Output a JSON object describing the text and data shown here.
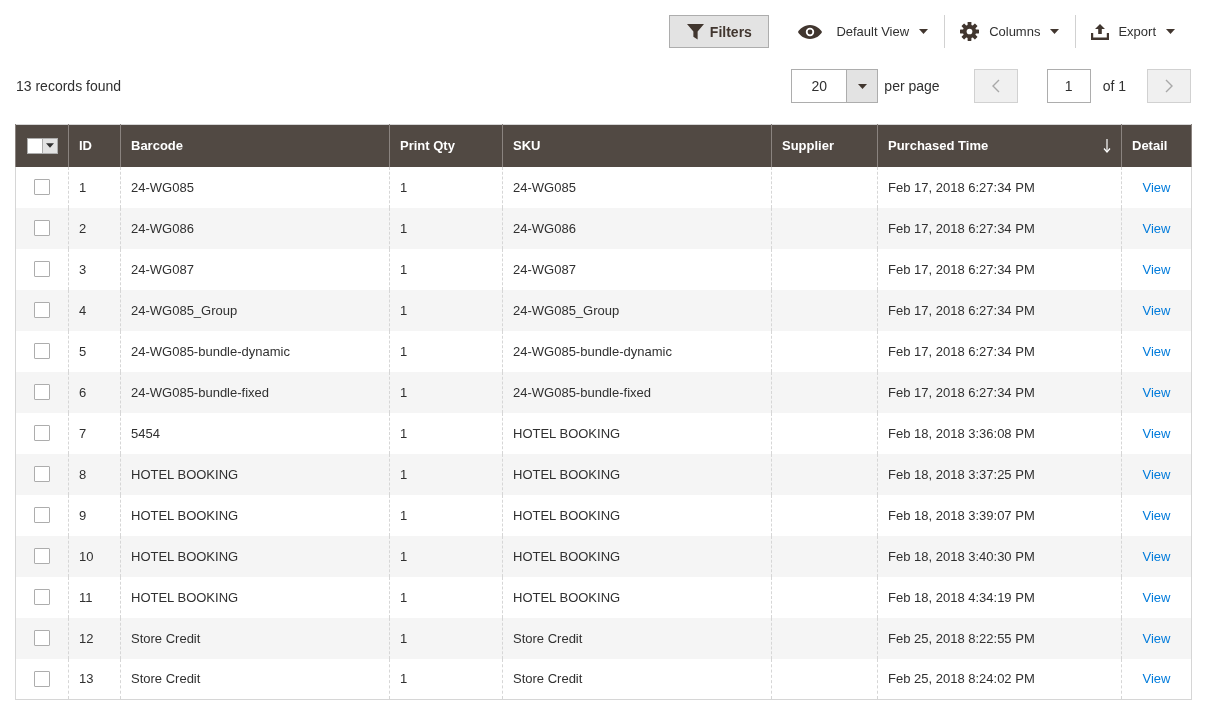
{
  "toolbar": {
    "filters_button": {
      "label": "Filters"
    },
    "menus": [
      {
        "kind": "view",
        "label": "Default View"
      },
      {
        "kind": "columns",
        "label": "Columns"
      },
      {
        "kind": "export",
        "label": "Export"
      }
    ]
  },
  "records_found": "13 records found",
  "pagination": {
    "per_page": {
      "value": "20",
      "label": "per page"
    },
    "prev_button": {
      "disabled": true
    },
    "page": {
      "value": "1"
    },
    "page_total": "of 1",
    "next_button": {
      "disabled": true
    }
  },
  "table": {
    "select_all": {
      "checked": false
    },
    "columns": [
      {
        "label": "ID",
        "sorted": false
      },
      {
        "label": "Barcode",
        "sorted": false
      },
      {
        "label": "Print Qty",
        "sorted": false
      },
      {
        "label": "SKU",
        "sorted": false
      },
      {
        "label": "Supplier",
        "sorted": false
      },
      {
        "label": "Purchased Time",
        "sorted": true,
        "descending": true
      },
      {
        "label": "Detail",
        "sorted": false
      }
    ],
    "rows": [
      {
        "selected": false,
        "id": "1",
        "barcode": "24-WG085",
        "print_qty": "1",
        "sku": "24-WG085",
        "purchased_time": "Feb 17, 2018 6:27:34 PM",
        "detail": "View"
      },
      {
        "selected": false,
        "id": "2",
        "barcode": "24-WG086",
        "print_qty": "1",
        "sku": "24-WG086",
        "purchased_time": "Feb 17, 2018 6:27:34 PM",
        "detail": "View"
      },
      {
        "selected": false,
        "id": "3",
        "barcode": "24-WG087",
        "print_qty": "1",
        "sku": "24-WG087",
        "purchased_time": "Feb 17, 2018 6:27:34 PM",
        "detail": "View"
      },
      {
        "selected": false,
        "id": "4",
        "barcode": "24-WG085_Group",
        "print_qty": "1",
        "sku": "24-WG085_Group",
        "purchased_time": "Feb 17, 2018 6:27:34 PM",
        "detail": "View"
      },
      {
        "selected": false,
        "id": "5",
        "barcode": "24-WG085-bundle-dynamic",
        "print_qty": "1",
        "sku": "24-WG085-bundle-dynamic",
        "purchased_time": "Feb 17, 2018 6:27:34 PM",
        "detail": "View"
      },
      {
        "selected": false,
        "id": "6",
        "barcode": "24-WG085-bundle-fixed",
        "print_qty": "1",
        "sku": "24-WG085-bundle-fixed",
        "purchased_time": "Feb 17, 2018 6:27:34 PM",
        "detail": "View"
      },
      {
        "selected": false,
        "id": "7",
        "barcode": "5454",
        "print_qty": "1",
        "sku": "HOTEL BOOKING",
        "purchased_time": "Feb 18, 2018 3:36:08 PM",
        "detail": "View"
      },
      {
        "selected": false,
        "id": "8",
        "barcode": "HOTEL BOOKING",
        "print_qty": "1",
        "sku": "HOTEL BOOKING",
        "purchased_time": "Feb 18, 2018 3:37:25 PM",
        "detail": "View"
      },
      {
        "selected": false,
        "id": "9",
        "barcode": "HOTEL BOOKING",
        "print_qty": "1",
        "sku": "HOTEL BOOKING",
        "purchased_time": "Feb 18, 2018 3:39:07 PM",
        "detail": "View"
      },
      {
        "selected": false,
        "id": "10",
        "barcode": "HOTEL BOOKING",
        "print_qty": "1",
        "sku": "HOTEL BOOKING",
        "purchased_time": "Feb 18, 2018 3:40:30 PM",
        "detail": "View"
      },
      {
        "selected": false,
        "id": "11",
        "barcode": "HOTEL BOOKING",
        "print_qty": "1",
        "sku": "HOTEL BOOKING",
        "purchased_time": "Feb 18, 2018 4:34:19 PM",
        "detail": "View"
      },
      {
        "selected": false,
        "id": "12",
        "barcode": "Store Credit",
        "print_qty": "1",
        "sku": "Store Credit",
        "purchased_time": "Feb 25, 2018 8:22:55 PM",
        "detail": "View"
      },
      {
        "selected": false,
        "id": "13",
        "barcode": "Store Credit",
        "print_qty": "1",
        "sku": "Store Credit",
        "purchased_time": "Feb 25, 2018 8:24:02 PM",
        "detail": "View"
      }
    ]
  }
}
